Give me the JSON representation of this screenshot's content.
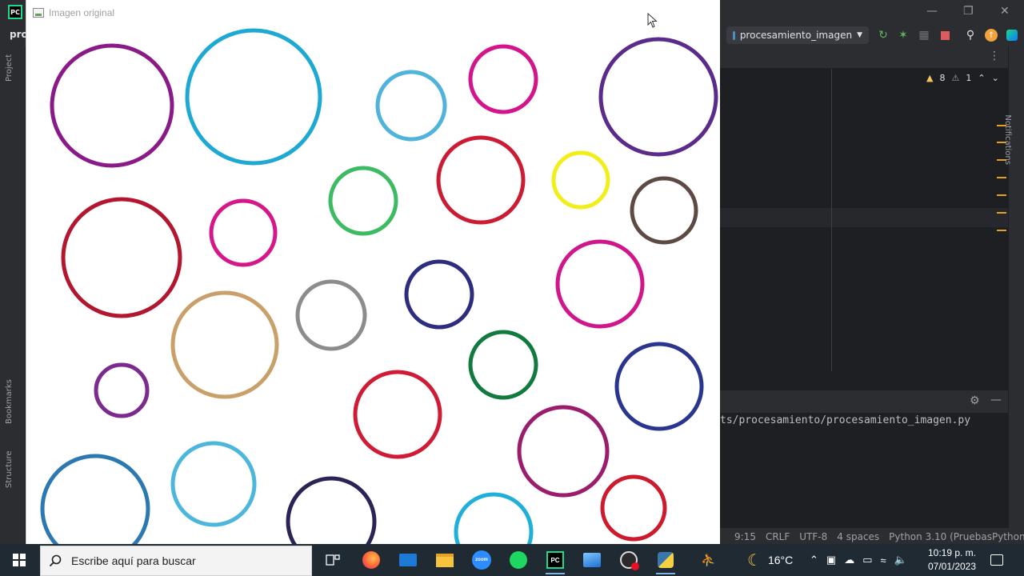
{
  "ide": {
    "project_name": "pro",
    "run_config": "procesamiento_imagen",
    "left_tools": [
      "Project",
      "Bookmarks",
      "Structure"
    ],
    "right_tools": [
      "Notifications"
    ],
    "inspections": {
      "warnings": "8",
      "errors": "1"
    },
    "run_output_path": "ts/procesamiento/procesamiento_imagen.py",
    "status_bar": {
      "position": "9:15",
      "line_sep": "CRLF",
      "encoding": "UTF-8",
      "indent": "4 spaces",
      "interpreter": "Python 3.10 (PruebasPython)"
    }
  },
  "image_window": {
    "title": "Imagen original",
    "circles": [
      {
        "color": "#8b1a89"
      },
      {
        "color": "#1ea9d3"
      },
      {
        "color": "#4fb3dc"
      },
      {
        "color": "#d4148a"
      },
      {
        "color": "#5b2b8c"
      },
      {
        "color": "#cc1c34"
      },
      {
        "color": "#f2ee1a"
      },
      {
        "color": "#3dbb62"
      },
      {
        "color": "#b3162f"
      },
      {
        "color": "#d51788"
      },
      {
        "color": "#5e4a44"
      },
      {
        "color": "#d1158b"
      },
      {
        "color": "#2e2c7e"
      },
      {
        "color": "#8c8c8c"
      },
      {
        "color": "#c9a06a"
      },
      {
        "color": "#7c2a8e"
      },
      {
        "color": "#117a3e"
      },
      {
        "color": "#2a3590"
      },
      {
        "color": "#cf1b35"
      },
      {
        "color": "#9a1c6a"
      },
      {
        "color": "#2c78b0"
      },
      {
        "color": "#4cb6dc"
      },
      {
        "color": "#2a2456"
      },
      {
        "color": "#1fb0da"
      },
      {
        "color": "#cd1a2e"
      }
    ]
  },
  "taskbar": {
    "search_placeholder": "Escribe aquí para buscar",
    "temperature": "16°C",
    "time": "10:19 p. m.",
    "date": "07/01/2023"
  }
}
